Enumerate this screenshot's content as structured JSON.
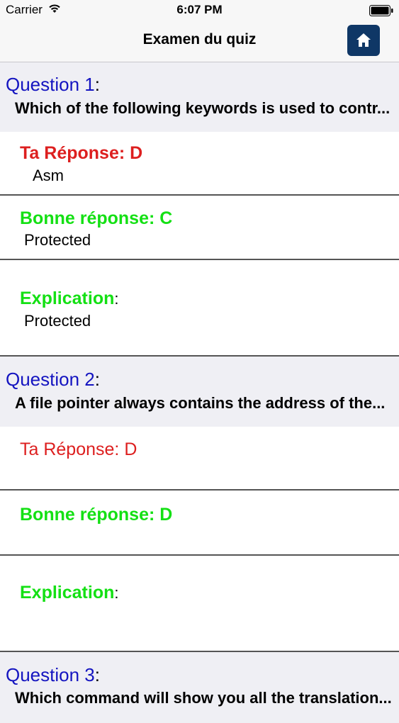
{
  "status_bar": {
    "carrier": "Carrier",
    "time": "6:07 PM",
    "wifi_icon": "wifi-icon",
    "battery_icon": "battery-icon"
  },
  "nav": {
    "title": "Examen du quiz",
    "home_icon": "home-icon",
    "home_button_color": "#0f3766"
  },
  "colors": {
    "question_title": "#1414c0",
    "your_answer": "#dd1f1f",
    "correct_answer": "#14e014",
    "section_background": "#efeff4"
  },
  "questions": [
    {
      "title": "Question 1",
      "colon": ":",
      "text": "Which of the following keywords is used to contr...",
      "your_answer_label": "Ta Réponse: D",
      "your_answer_text": "Asm",
      "correct_label": "Bonne réponse: C",
      "correct_text": "Protected",
      "explanation_label": "Explication",
      "explanation_colon": ":",
      "explanation_text": "Protected"
    },
    {
      "title": "Question 2",
      "colon": ":",
      "text": "A file pointer always contains the address of the...",
      "your_answer_label": "Ta Réponse: D",
      "your_answer_text": "",
      "correct_label": "Bonne réponse: D",
      "correct_text": "",
      "explanation_label": "Explication",
      "explanation_colon": ":",
      "explanation_text": ""
    },
    {
      "title": "Question 3",
      "colon": ":",
      "text": "Which command will show you all the translation..."
    }
  ]
}
